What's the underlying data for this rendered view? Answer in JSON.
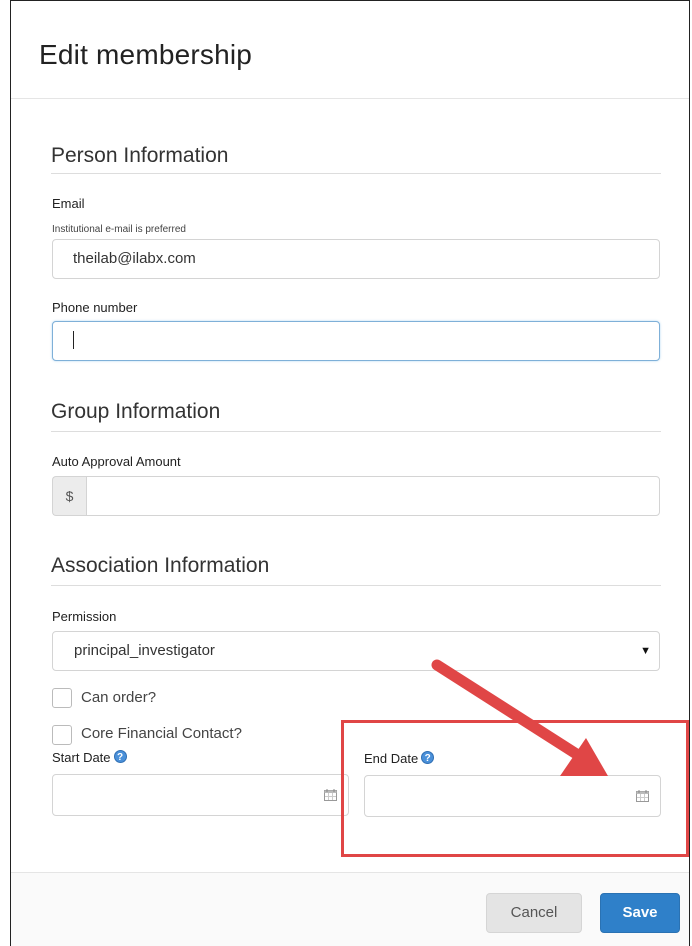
{
  "modal": {
    "title": "Edit membership"
  },
  "person": {
    "section_title": "Person Information",
    "email_label": "Email",
    "email_help": "Institutional e-mail is preferred",
    "email_value": "theilab@ilabx.com",
    "phone_label": "Phone number",
    "phone_value": ""
  },
  "group": {
    "section_title": "Group Information",
    "auto_approval_label": "Auto Approval Amount",
    "currency_symbol": "$",
    "auto_approval_value": ""
  },
  "association": {
    "section_title": "Association Information",
    "permission_label": "Permission",
    "permission_value": "principal_investigator",
    "can_order_label": "Can order?",
    "core_financial_label": "Core Financial Contact?",
    "start_date_label": "Start Date",
    "end_date_label": "End Date",
    "start_date_value": "",
    "end_date_value": ""
  },
  "icons": {
    "help": "question-circle-icon",
    "calendar": "calendar-icon",
    "dropdown": "caret-down-icon"
  },
  "footer": {
    "cancel_label": "Cancel",
    "save_label": "Save"
  },
  "colors": {
    "primary": "#2f80c9",
    "highlight": "#e04646",
    "help_icon": "#4a90d9"
  }
}
